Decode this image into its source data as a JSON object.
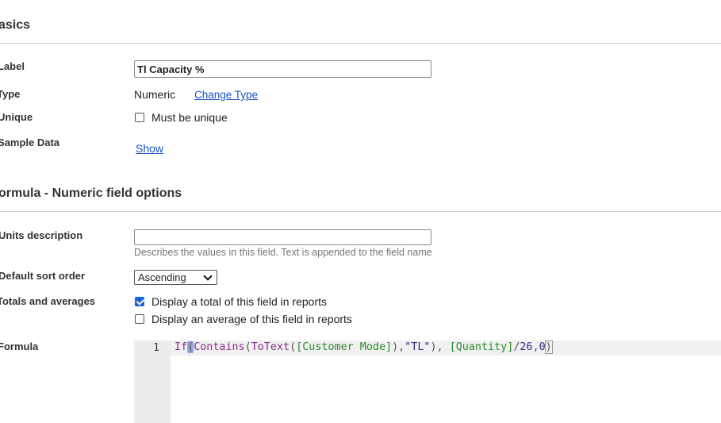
{
  "basics": {
    "title": "asics",
    "label": {
      "label": "Label",
      "value": "Tl Capacity %"
    },
    "type": {
      "label": "Type",
      "value": "Numeric",
      "change_link": "Change Type"
    },
    "unique": {
      "label": "Unique",
      "checkbox_label": "Must be unique",
      "checked": false
    },
    "sample_data": {
      "label": "Sample Data",
      "link": "Show"
    }
  },
  "formula_section": {
    "title": "ormula - Numeric field options",
    "units": {
      "label": "Units description",
      "value": "",
      "hint": "Describes the values in this field. Text is appended to the field name"
    },
    "sort": {
      "label": "Default sort order",
      "selected": "Ascending"
    },
    "totals": {
      "label": "Totals and averages",
      "total_label": "Display a total of this field in reports",
      "total_checked": true,
      "average_label": "Display an average of this field in reports",
      "average_checked": false
    },
    "formula": {
      "label": "Formula",
      "line_number": "1",
      "code_tokens": [
        "If",
        "(",
        "Contains",
        "(",
        "ToText",
        "(",
        "[Customer Mode]",
        "),",
        "\"TL\"",
        "), ",
        "[Quantity]",
        "/",
        "26",
        ",",
        "0",
        ")"
      ]
    }
  },
  "colors": {
    "link": "#1a52c8",
    "checkbox_checked": "#1a62d6"
  }
}
